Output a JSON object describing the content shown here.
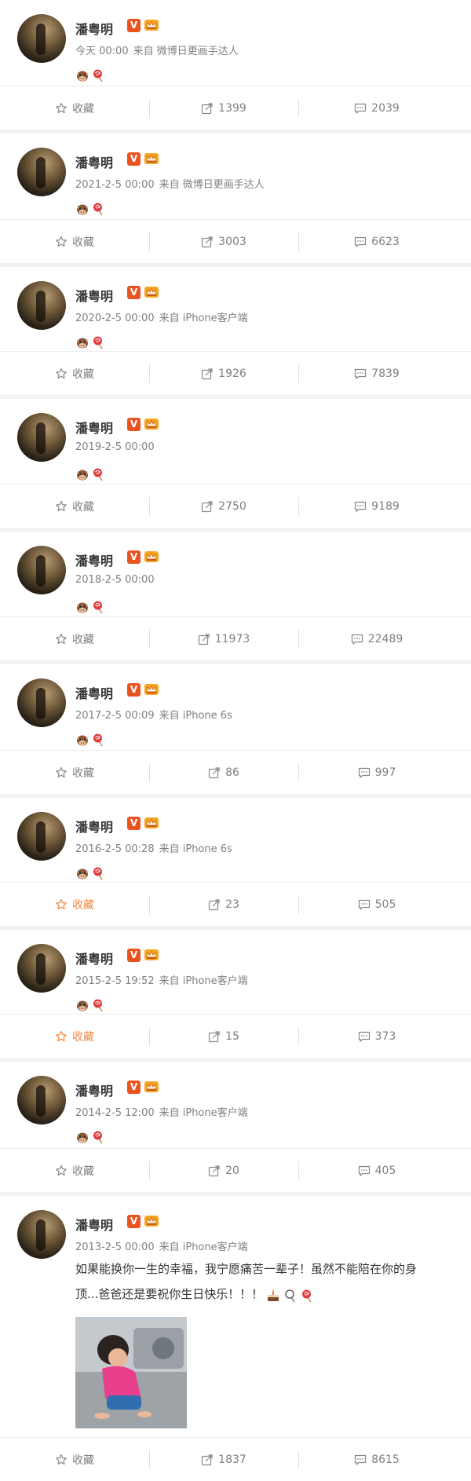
{
  "colors": {
    "accent_orange": "#e8531f",
    "muted": "#808080",
    "text": "#333333",
    "fav_active": "#ef8a45"
  },
  "posts": [
    {
      "author": "潘粤明",
      "vip": "V",
      "time": "今天 00:00",
      "source": "来自 微博日更画手达人",
      "emojis": [
        "cow-face",
        "lollipop"
      ],
      "actions": {
        "favorite": "收藏",
        "reposts": "1399",
        "comments": "2039",
        "favorite_icon": "star-outline"
      }
    },
    {
      "author": "潘粤明",
      "vip": "V",
      "time": "2021-2-5 00:00",
      "source": "来自 微博日更画手达人",
      "emojis": [
        "cow-face",
        "lollipop"
      ],
      "actions": {
        "favorite": "收藏",
        "reposts": "3003",
        "comments": "6623",
        "favorite_icon": "star-outline"
      }
    },
    {
      "author": "潘粤明",
      "vip": "V",
      "time": "2020-2-5 00:00",
      "source": "来自 iPhone客户端",
      "emojis": [
        "cow-face",
        "lollipop"
      ],
      "actions": {
        "favorite": "收藏",
        "reposts": "1926",
        "comments": "7839",
        "favorite_icon": "star-outline"
      }
    },
    {
      "author": "潘粤明",
      "vip": "V",
      "time": "2019-2-5 00:00",
      "source": "",
      "emojis": [
        "cow-face",
        "lollipop"
      ],
      "actions": {
        "favorite": "收藏",
        "reposts": "2750",
        "comments": "9189",
        "favorite_icon": "star-outline"
      }
    },
    {
      "author": "潘粤明",
      "vip": "V",
      "time": "2018-2-5 00:00",
      "source": "",
      "emojis": [
        "cow-face",
        "lollipop"
      ],
      "actions": {
        "favorite": "收藏",
        "reposts": "11973",
        "comments": "22489",
        "favorite_icon": "star-outline"
      }
    },
    {
      "author": "潘粤明",
      "vip": "V",
      "time": "2017-2-5 00:09",
      "source": "来自 iPhone 6s",
      "emojis": [
        "cow-face",
        "lollipop"
      ],
      "actions": {
        "favorite": "收藏",
        "reposts": "86",
        "comments": "997",
        "favorite_icon": "star-outline"
      }
    },
    {
      "author": "潘粤明",
      "vip": "V",
      "time": "2016-2-5 00:28",
      "source": "来自 iPhone 6s",
      "emojis": [
        "cow-face",
        "lollipop"
      ],
      "actions": {
        "favorite": "收藏",
        "reposts": "23",
        "comments": "505",
        "favorite_icon": "star-orange"
      }
    },
    {
      "author": "潘粤明",
      "vip": "V",
      "time": "2015-2-5 19:52",
      "source": "来自 iPhone客户端",
      "emojis": [
        "cow-face",
        "lollipop"
      ],
      "actions": {
        "favorite": "收藏",
        "reposts": "15",
        "comments": "373",
        "favorite_icon": "star-orange"
      }
    },
    {
      "author": "潘粤明",
      "vip": "V",
      "time": "2014-2-5 12:00",
      "source": "来自 iPhone客户端",
      "emojis": [
        "cow-face",
        "lollipop"
      ],
      "actions": {
        "favorite": "收藏",
        "reposts": "20",
        "comments": "405",
        "favorite_icon": "star-outline"
      }
    },
    {
      "author": "潘粤明",
      "vip": "V",
      "time": "2013-2-5 00:00",
      "source": "来自 iPhone客户端",
      "emojis": [],
      "text_line1": "如果能换你一生的幸福，我宁愿痛苦一辈子！虽然不能陪在你的身",
      "text_line2": "顶...爸爸还是要祝你生日快乐！！！",
      "text_emojis": [
        "cake",
        "lollipop-hollow",
        "lollipop"
      ],
      "has_photo": true,
      "actions": {
        "favorite": "收藏",
        "reposts": "1837",
        "comments": "8615",
        "favorite_icon": "star-outline"
      }
    }
  ]
}
